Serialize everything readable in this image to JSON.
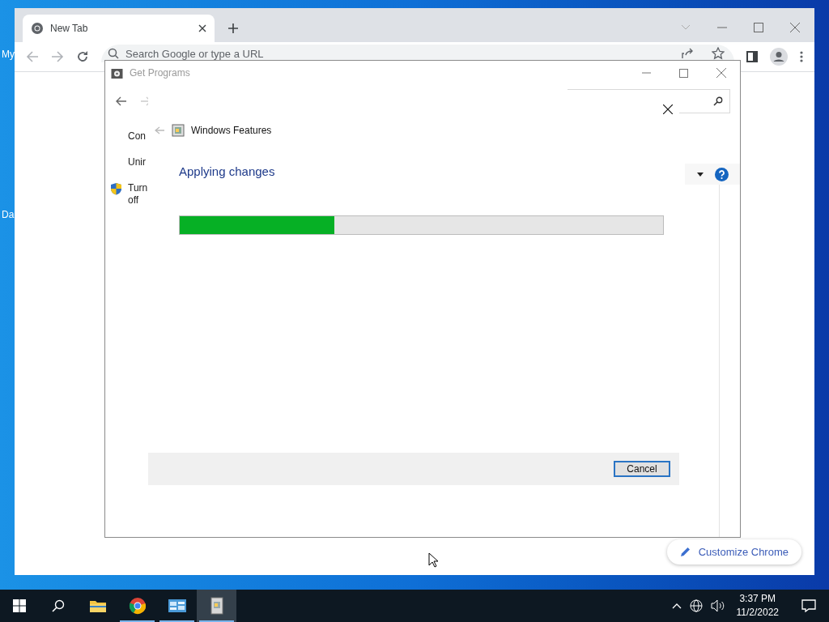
{
  "desktop": {
    "icon_labels": [
      "My",
      "Da"
    ]
  },
  "browser": {
    "tabs": [
      {
        "label": "New Tab",
        "selected": true
      }
    ],
    "omnibox": {
      "placeholder": "Search Google or type a URL"
    },
    "customize_button": "Customize Chrome"
  },
  "control_panel": {
    "title": "Get Programs",
    "sidebar_items": [
      {
        "label": "Con",
        "kind": "link"
      },
      {
        "label": "Unir",
        "kind": "link"
      },
      {
        "label": "Turn off",
        "kind": "shield"
      }
    ]
  },
  "features_dialog": {
    "title": "Windows Features",
    "status": "Applying changes",
    "progress": {
      "level": 0.32
    },
    "buttons": [
      "Cancel"
    ]
  },
  "taskbar": {
    "apps": [
      {
        "kind": "explorer",
        "running": false,
        "selected": false
      },
      {
        "kind": "chrome",
        "running": true,
        "selected": false
      },
      {
        "kind": "control-panel",
        "running": true,
        "selected": false
      },
      {
        "kind": "features",
        "running": true,
        "selected": true
      }
    ],
    "clock": {
      "time": "3:37 PM",
      "date": "11/2/2022"
    }
  }
}
